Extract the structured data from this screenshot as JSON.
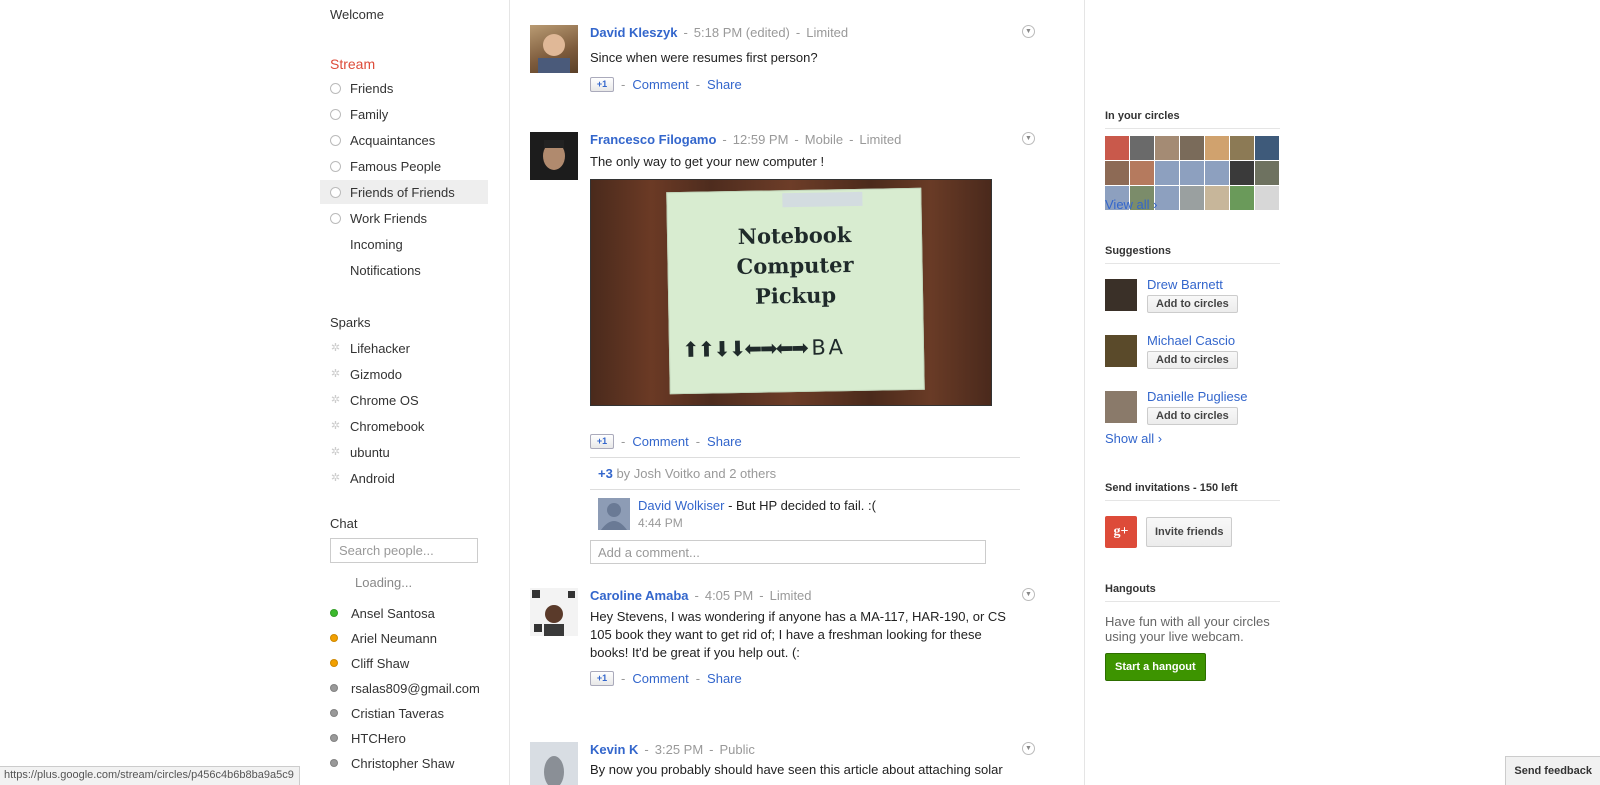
{
  "nav": {
    "welcome": "Welcome",
    "stream": "Stream",
    "circles": [
      "Friends",
      "Family",
      "Acquaintances",
      "Famous People",
      "Friends of Friends",
      "Work Friends"
    ],
    "active_circle": "Friends of Friends",
    "incoming": "Incoming",
    "notifications": "Notifications",
    "sparks_label": "Sparks",
    "sparks": [
      "Lifehacker",
      "Gizmodo",
      "Chrome OS",
      "Chromebook",
      "ubuntu",
      "Android"
    ],
    "chat_label": "Chat",
    "chat_search_placeholder": "Search people...",
    "chat_loading": "Loading...",
    "chat_contacts": [
      {
        "name": "Ansel Santosa",
        "status_color": "#3cba2d"
      },
      {
        "name": "Ariel Neumann",
        "status_color": "#f2a000"
      },
      {
        "name": "Cliff Shaw",
        "status_color": "#f2a000"
      },
      {
        "name": "rsalas809@gmail.com",
        "status_color": "#999999"
      },
      {
        "name": "Cristian Taveras",
        "status_color": "#999999"
      },
      {
        "name": "HTCHero",
        "status_color": "#999999"
      },
      {
        "name": "Christopher Shaw",
        "status_color": "#999999"
      }
    ]
  },
  "posts": [
    {
      "author": "David Kleszyk",
      "time": "5:18 PM (edited)",
      "visibility": "Limited",
      "text": "Since when were resumes first person?",
      "plusone": "+1",
      "comment": "Comment",
      "share": "Share"
    },
    {
      "author": "Francesco Filogamo",
      "time": "12:59 PM",
      "via": "Mobile",
      "visibility": "Limited",
      "text": "The only way to get your new computer !",
      "photo": {
        "line1": "Notebook",
        "line2": "Computer",
        "line3": "Pickup",
        "arrows": "⬆⬆⬇⬇⬅➡⬅➡ B A"
      },
      "plusone": "+1",
      "comment": "Comment",
      "share": "Share",
      "plus_count": "+3",
      "plus_by": "by Josh Voitko and 2 others",
      "comments": [
        {
          "author": "David Wolkiser",
          "text": " - But HP decided to fail. :(",
          "time": "4:44 PM"
        }
      ],
      "add_comment_placeholder": "Add a comment..."
    },
    {
      "author": "Caroline Amaba",
      "time": "4:05 PM",
      "visibility": "Limited",
      "text": "Hey Stevens, I was wondering if anyone has a MA-117, HAR-190, or CS 105 book they want to get rid of; I have a freshman looking for these books! It'd be great if you help out. (:",
      "plusone": "+1",
      "comment": "Comment",
      "share": "Share"
    },
    {
      "author": "Kevin K",
      "time": "3:25 PM",
      "visibility": "Public",
      "text": "By now you probably should have seen this article about attaching solar"
    }
  ],
  "right": {
    "in_circles_heading": "In your circles",
    "circle_colors": [
      "#c9594b",
      "#6a6a6a",
      "#a48b74",
      "#7a6b5a",
      "#d0a26e",
      "#8c7a55",
      "#3e5a7a",
      "#8d6a55",
      "#b57a5e",
      "#8da0bf",
      "#8da0bf",
      "#8da0bf",
      "#3a3a3a",
      "#6e7260",
      "#8da0bf",
      "#7b8c6a",
      "#8da0bf",
      "#9aa0a0",
      "#c7b69a",
      "#6a9a5a",
      "#d7d7d7"
    ],
    "view_all": "View all ›",
    "suggestions_heading": "Suggestions",
    "suggestions": [
      {
        "name": "Drew Barnett",
        "button": "Add to circles",
        "color": "#3a3028"
      },
      {
        "name": "Michael Cascio",
        "button": "Add to circles",
        "color": "#5a4a2a"
      },
      {
        "name": "Danielle Pugliese",
        "button": "Add to circles",
        "color": "#8a7a6a"
      }
    ],
    "show_all": "Show all ›",
    "invite_heading": "Send invitations - 150 left",
    "invite_icon": "g+",
    "invite_button": "Invite friends",
    "hangouts_heading": "Hangouts",
    "hangouts_desc": "Have fun with all your circles using your live webcam.",
    "hangout_button": "Start a hangout"
  },
  "footer": {
    "status_url": "https://plus.google.com/stream/circles/p456c4b6b8ba9a5c9",
    "feedback": "Send feedback"
  }
}
